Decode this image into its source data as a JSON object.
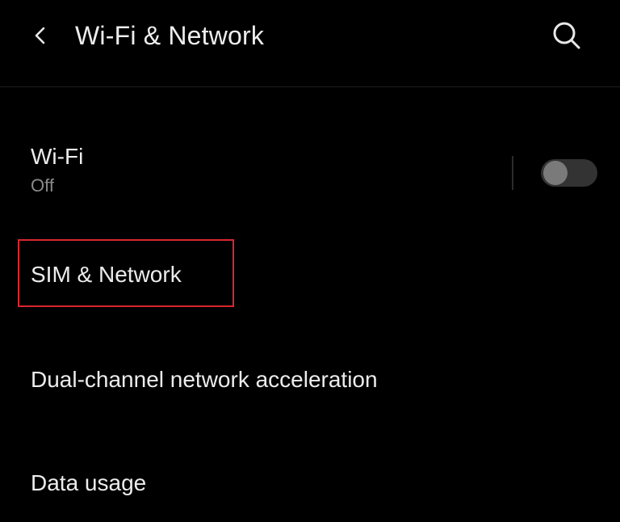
{
  "header": {
    "title": "Wi-Fi & Network",
    "back_icon": "chevron-left-icon",
    "search_icon": "search-icon"
  },
  "settings": {
    "wifi": {
      "label": "Wi-Fi",
      "status": "Off",
      "toggle_on": false
    },
    "sim_network": {
      "label": "SIM & Network",
      "highlighted": true
    },
    "dual_channel": {
      "label": "Dual-channel network acceleration"
    },
    "data_usage": {
      "label": "Data usage"
    }
  },
  "colors": {
    "background": "#000000",
    "text_primary": "#ececec",
    "text_secondary": "#8a8a8a",
    "highlight": "#d8262e",
    "toggle_track": "#333333",
    "toggle_knob": "#7a7a7a"
  }
}
